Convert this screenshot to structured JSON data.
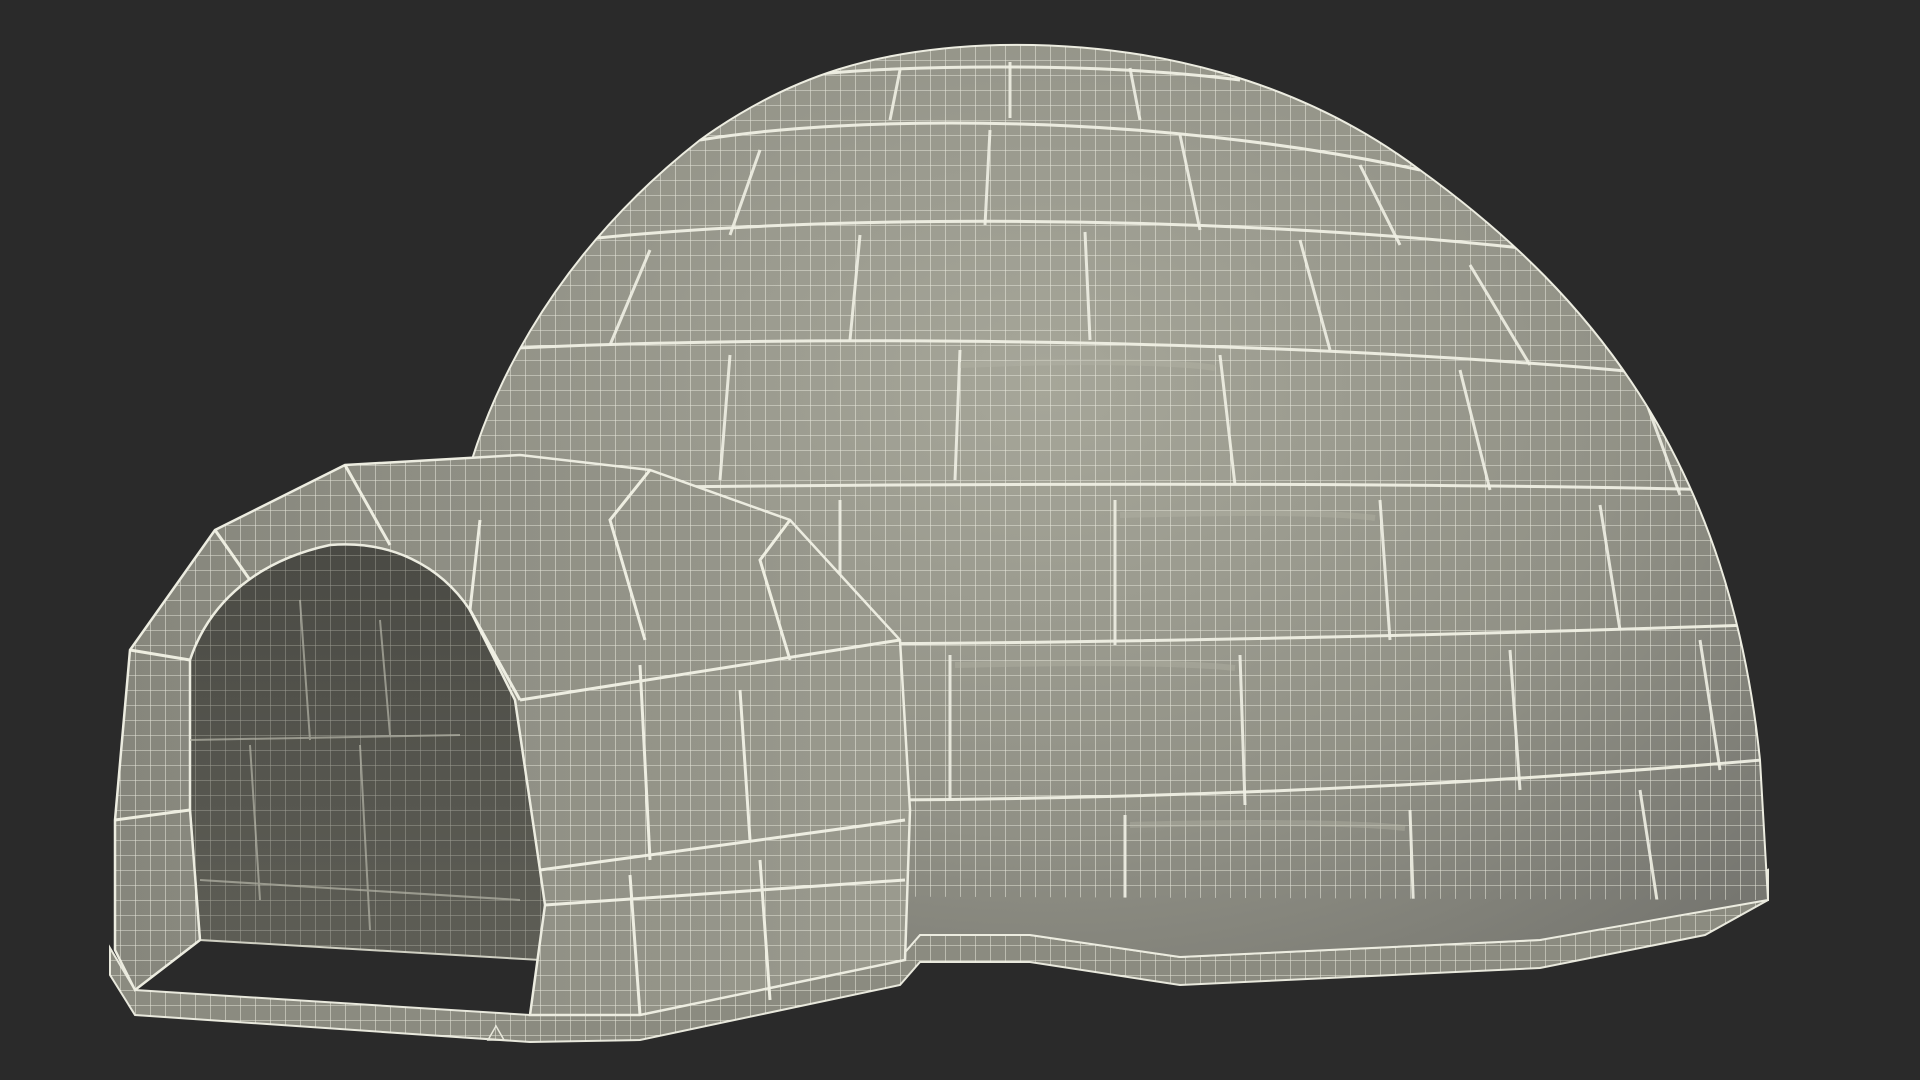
{
  "scene": {
    "subject": "igloo",
    "render_style": "wireframe-over-clay",
    "colors": {
      "background": "#2a2a2a",
      "surface": "#8f8f84",
      "surface_light": "#a3a396",
      "surface_dark": "#7a7a70",
      "interior": "#56564f",
      "wire": "#f2f2e6",
      "seam": "#e8e8dc"
    },
    "parts": [
      "dome",
      "entrance-tunnel",
      "tunnel-opening",
      "base-plinth"
    ]
  }
}
